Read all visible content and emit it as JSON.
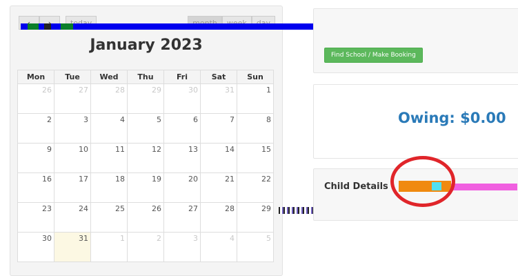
{
  "calendar": {
    "prev_label": "‹",
    "next_label": "›",
    "today_label": "today",
    "views": [
      "month",
      "week",
      "day"
    ],
    "title": "January 2023",
    "weekdays": [
      "Mon",
      "Tue",
      "Wed",
      "Thu",
      "Fri",
      "Sat",
      "Sun"
    ],
    "weeks": [
      [
        {
          "d": "26",
          "o": true
        },
        {
          "d": "27",
          "o": true
        },
        {
          "d": "28",
          "o": true
        },
        {
          "d": "29",
          "o": true
        },
        {
          "d": "30",
          "o": true
        },
        {
          "d": "31",
          "o": true
        },
        {
          "d": "1",
          "o": false
        }
      ],
      [
        {
          "d": "2"
        },
        {
          "d": "3"
        },
        {
          "d": "4"
        },
        {
          "d": "5"
        },
        {
          "d": "6"
        },
        {
          "d": "7"
        },
        {
          "d": "8"
        }
      ],
      [
        {
          "d": "9"
        },
        {
          "d": "10"
        },
        {
          "d": "11"
        },
        {
          "d": "12"
        },
        {
          "d": "13"
        },
        {
          "d": "14"
        },
        {
          "d": "15"
        }
      ],
      [
        {
          "d": "16"
        },
        {
          "d": "17"
        },
        {
          "d": "18"
        },
        {
          "d": "19"
        },
        {
          "d": "20"
        },
        {
          "d": "21"
        },
        {
          "d": "22"
        }
      ],
      [
        {
          "d": "23"
        },
        {
          "d": "24"
        },
        {
          "d": "25"
        },
        {
          "d": "26"
        },
        {
          "d": "27"
        },
        {
          "d": "28"
        },
        {
          "d": "29"
        }
      ],
      [
        {
          "d": "30"
        },
        {
          "d": "31",
          "today": true
        },
        {
          "d": "1",
          "o": true
        },
        {
          "d": "2",
          "o": true
        },
        {
          "d": "3",
          "o": true
        },
        {
          "d": "4",
          "o": true
        },
        {
          "d": "5",
          "o": true
        }
      ]
    ]
  },
  "booking": {
    "button_label": "Find School / Make Booking"
  },
  "balance": {
    "text": "Owing: $0.00"
  },
  "child": {
    "title": "Child Details"
  },
  "colors": {
    "accent": "#2a7ab8",
    "button": "#5cb85c",
    "highlight": "#e0252a",
    "today_bg": "#fcf8e3"
  }
}
